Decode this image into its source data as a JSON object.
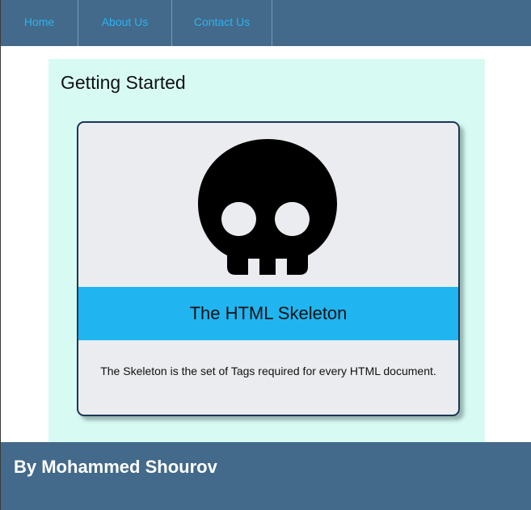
{
  "nav": {
    "items": [
      {
        "label": "Home"
      },
      {
        "label": "About Us"
      },
      {
        "label": "Contact Us"
      }
    ]
  },
  "main": {
    "heading": "Getting Started",
    "card": {
      "icon": "skull-icon",
      "title": "The HTML Skeleton",
      "description": "The Skeleton is the set of Tags required for every HTML document."
    }
  },
  "footer": {
    "text": "By Mohammed Shourov"
  },
  "colors": {
    "nav_bg": "#436a8a",
    "nav_link": "#2cb2f2",
    "content_bg": "#d7fbf3",
    "card_bg": "#ebecef",
    "card_border": "#1d3656",
    "band_bg": "#20b5f1",
    "footer_text": "#ffffff"
  }
}
